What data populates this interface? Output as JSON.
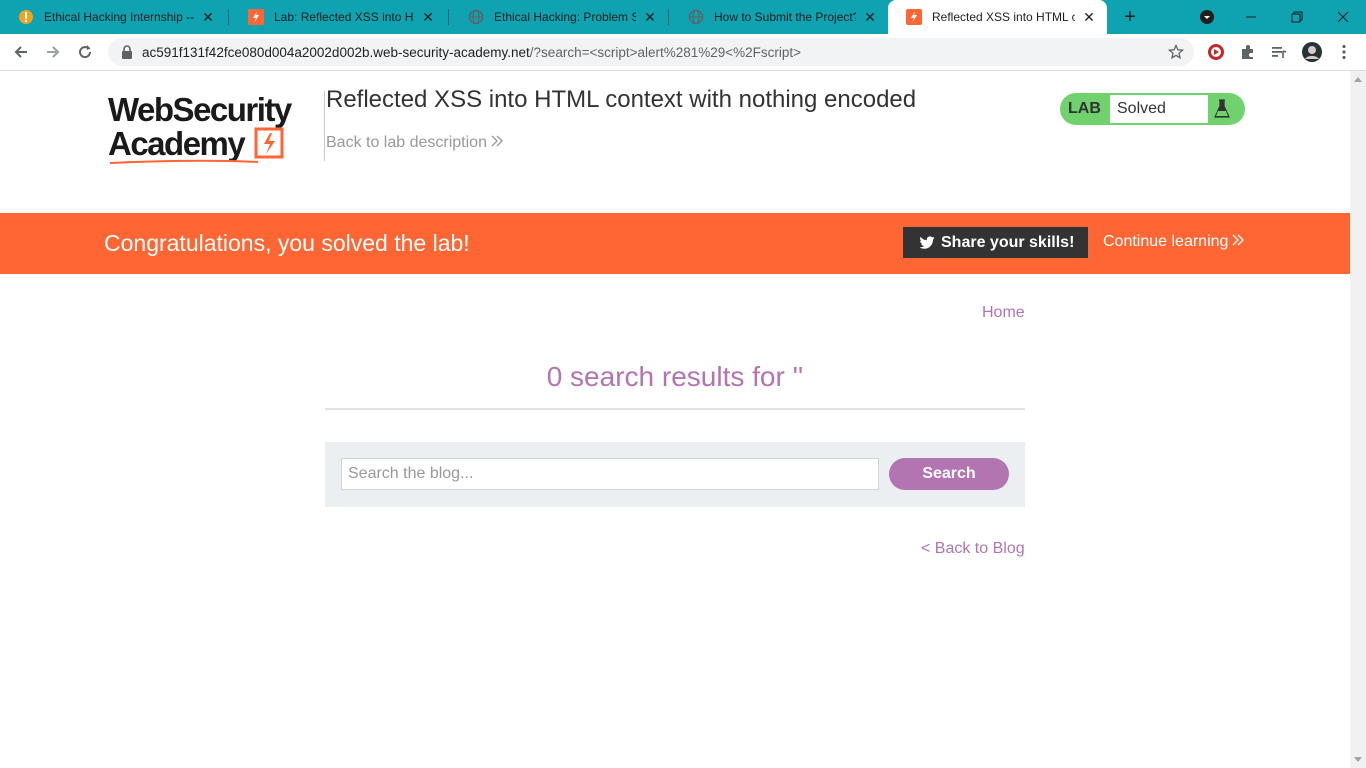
{
  "browser": {
    "tabs": [
      {
        "title": "Ethical Hacking Internship --",
        "favicon": "internshala-icon"
      },
      {
        "title": "Lab: Reflected XSS into HTML",
        "favicon": "portswigger-icon"
      },
      {
        "title": "Ethical Hacking: Problem Stat",
        "favicon": "globe-icon"
      },
      {
        "title": "How to Submit the Project?",
        "favicon": "globe-icon"
      },
      {
        "title": "Reflected XSS into HTML con",
        "favicon": "portswigger-icon"
      }
    ],
    "url_host": "ac591f131f42fce080d004a2002d002b.web-security-academy.net",
    "url_path": "/?search=<script>alert%281%29<%2Fscript>"
  },
  "header": {
    "logo_line1": "WebSecurity",
    "logo_line2": "Academy",
    "lab_title": "Reflected XSS into HTML context with nothing encoded",
    "back_to_description": "Back to lab description",
    "lab_tag": "LAB",
    "lab_status": "Solved"
  },
  "banner": {
    "message": "Congratulations, you solved the lab!",
    "share": "Share your skills!",
    "continue": "Continue learning"
  },
  "main": {
    "home": "Home",
    "results_heading": "0 search results for ''",
    "search_placeholder": "Search the blog...",
    "search_button": "Search",
    "back_to_blog": "< Back to Blog"
  },
  "colors": {
    "tabstrip": "#0fa2b0",
    "banner": "#ff6633",
    "accent": "#b374b2",
    "lab_solved": "#70d16d"
  }
}
